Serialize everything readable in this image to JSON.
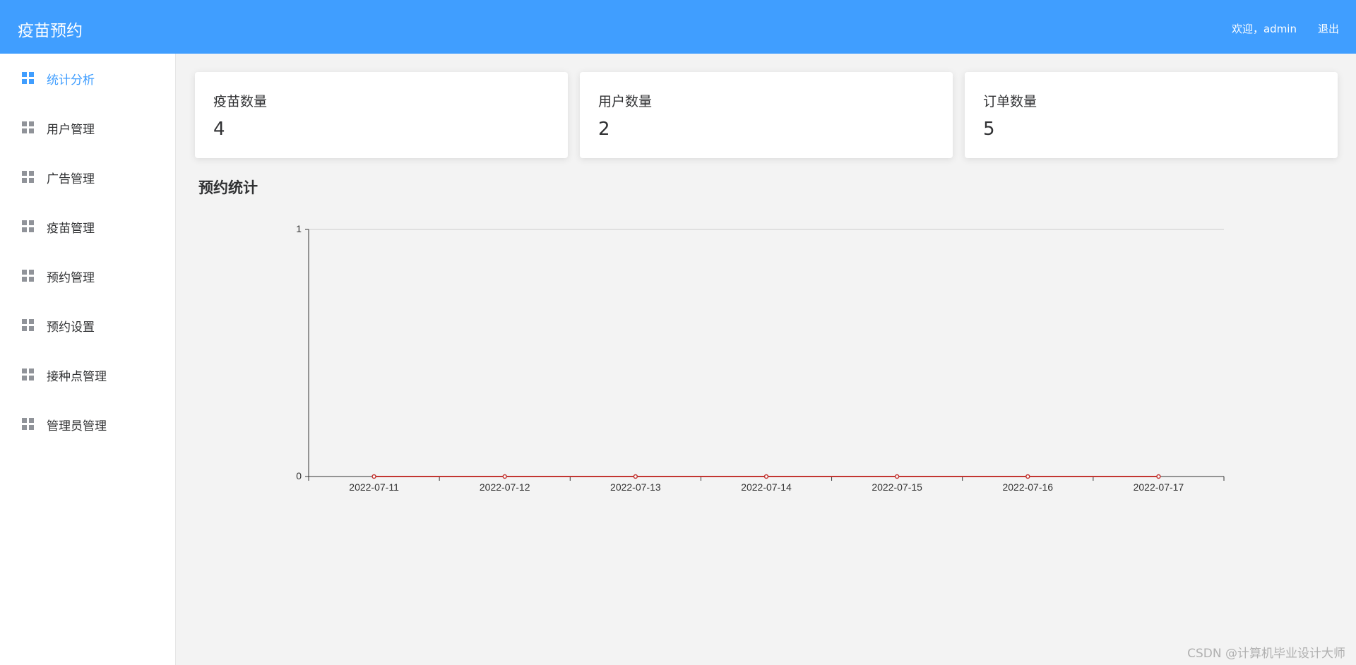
{
  "header": {
    "brand": "疫苗预约",
    "welcome": "欢迎，admin",
    "logout": "退出"
  },
  "sidebar": {
    "items": [
      {
        "label": "统计分析",
        "icon": "grid-icon",
        "active": true
      },
      {
        "label": "用户管理",
        "icon": "grid-icon"
      },
      {
        "label": "广告管理",
        "icon": "grid-icon"
      },
      {
        "label": "疫苗管理",
        "icon": "grid-icon"
      },
      {
        "label": "预约管理",
        "icon": "grid-icon"
      },
      {
        "label": "预约设置",
        "icon": "grid-icon"
      },
      {
        "label": "接种点管理",
        "icon": "grid-icon"
      },
      {
        "label": "管理员管理",
        "icon": "grid-icon"
      }
    ]
  },
  "stats": [
    {
      "title": "疫苗数量",
      "value": "4"
    },
    {
      "title": "用户数量",
      "value": "2"
    },
    {
      "title": "订单数量",
      "value": "5"
    }
  ],
  "section": {
    "title": "预约统计"
  },
  "colors": {
    "accent": "#409eff",
    "line": "#c23531"
  },
  "chart_data": {
    "type": "line",
    "categories": [
      "2022-07-11",
      "2022-07-12",
      "2022-07-13",
      "2022-07-14",
      "2022-07-15",
      "2022-07-16",
      "2022-07-17"
    ],
    "series": [
      {
        "values": [
          0,
          0,
          0,
          0,
          0,
          0,
          0
        ]
      }
    ],
    "ylim": [
      0,
      1
    ],
    "yticks": [
      "0",
      "1"
    ],
    "grid": true
  },
  "watermark": "CSDN @计算机毕业设计大师"
}
